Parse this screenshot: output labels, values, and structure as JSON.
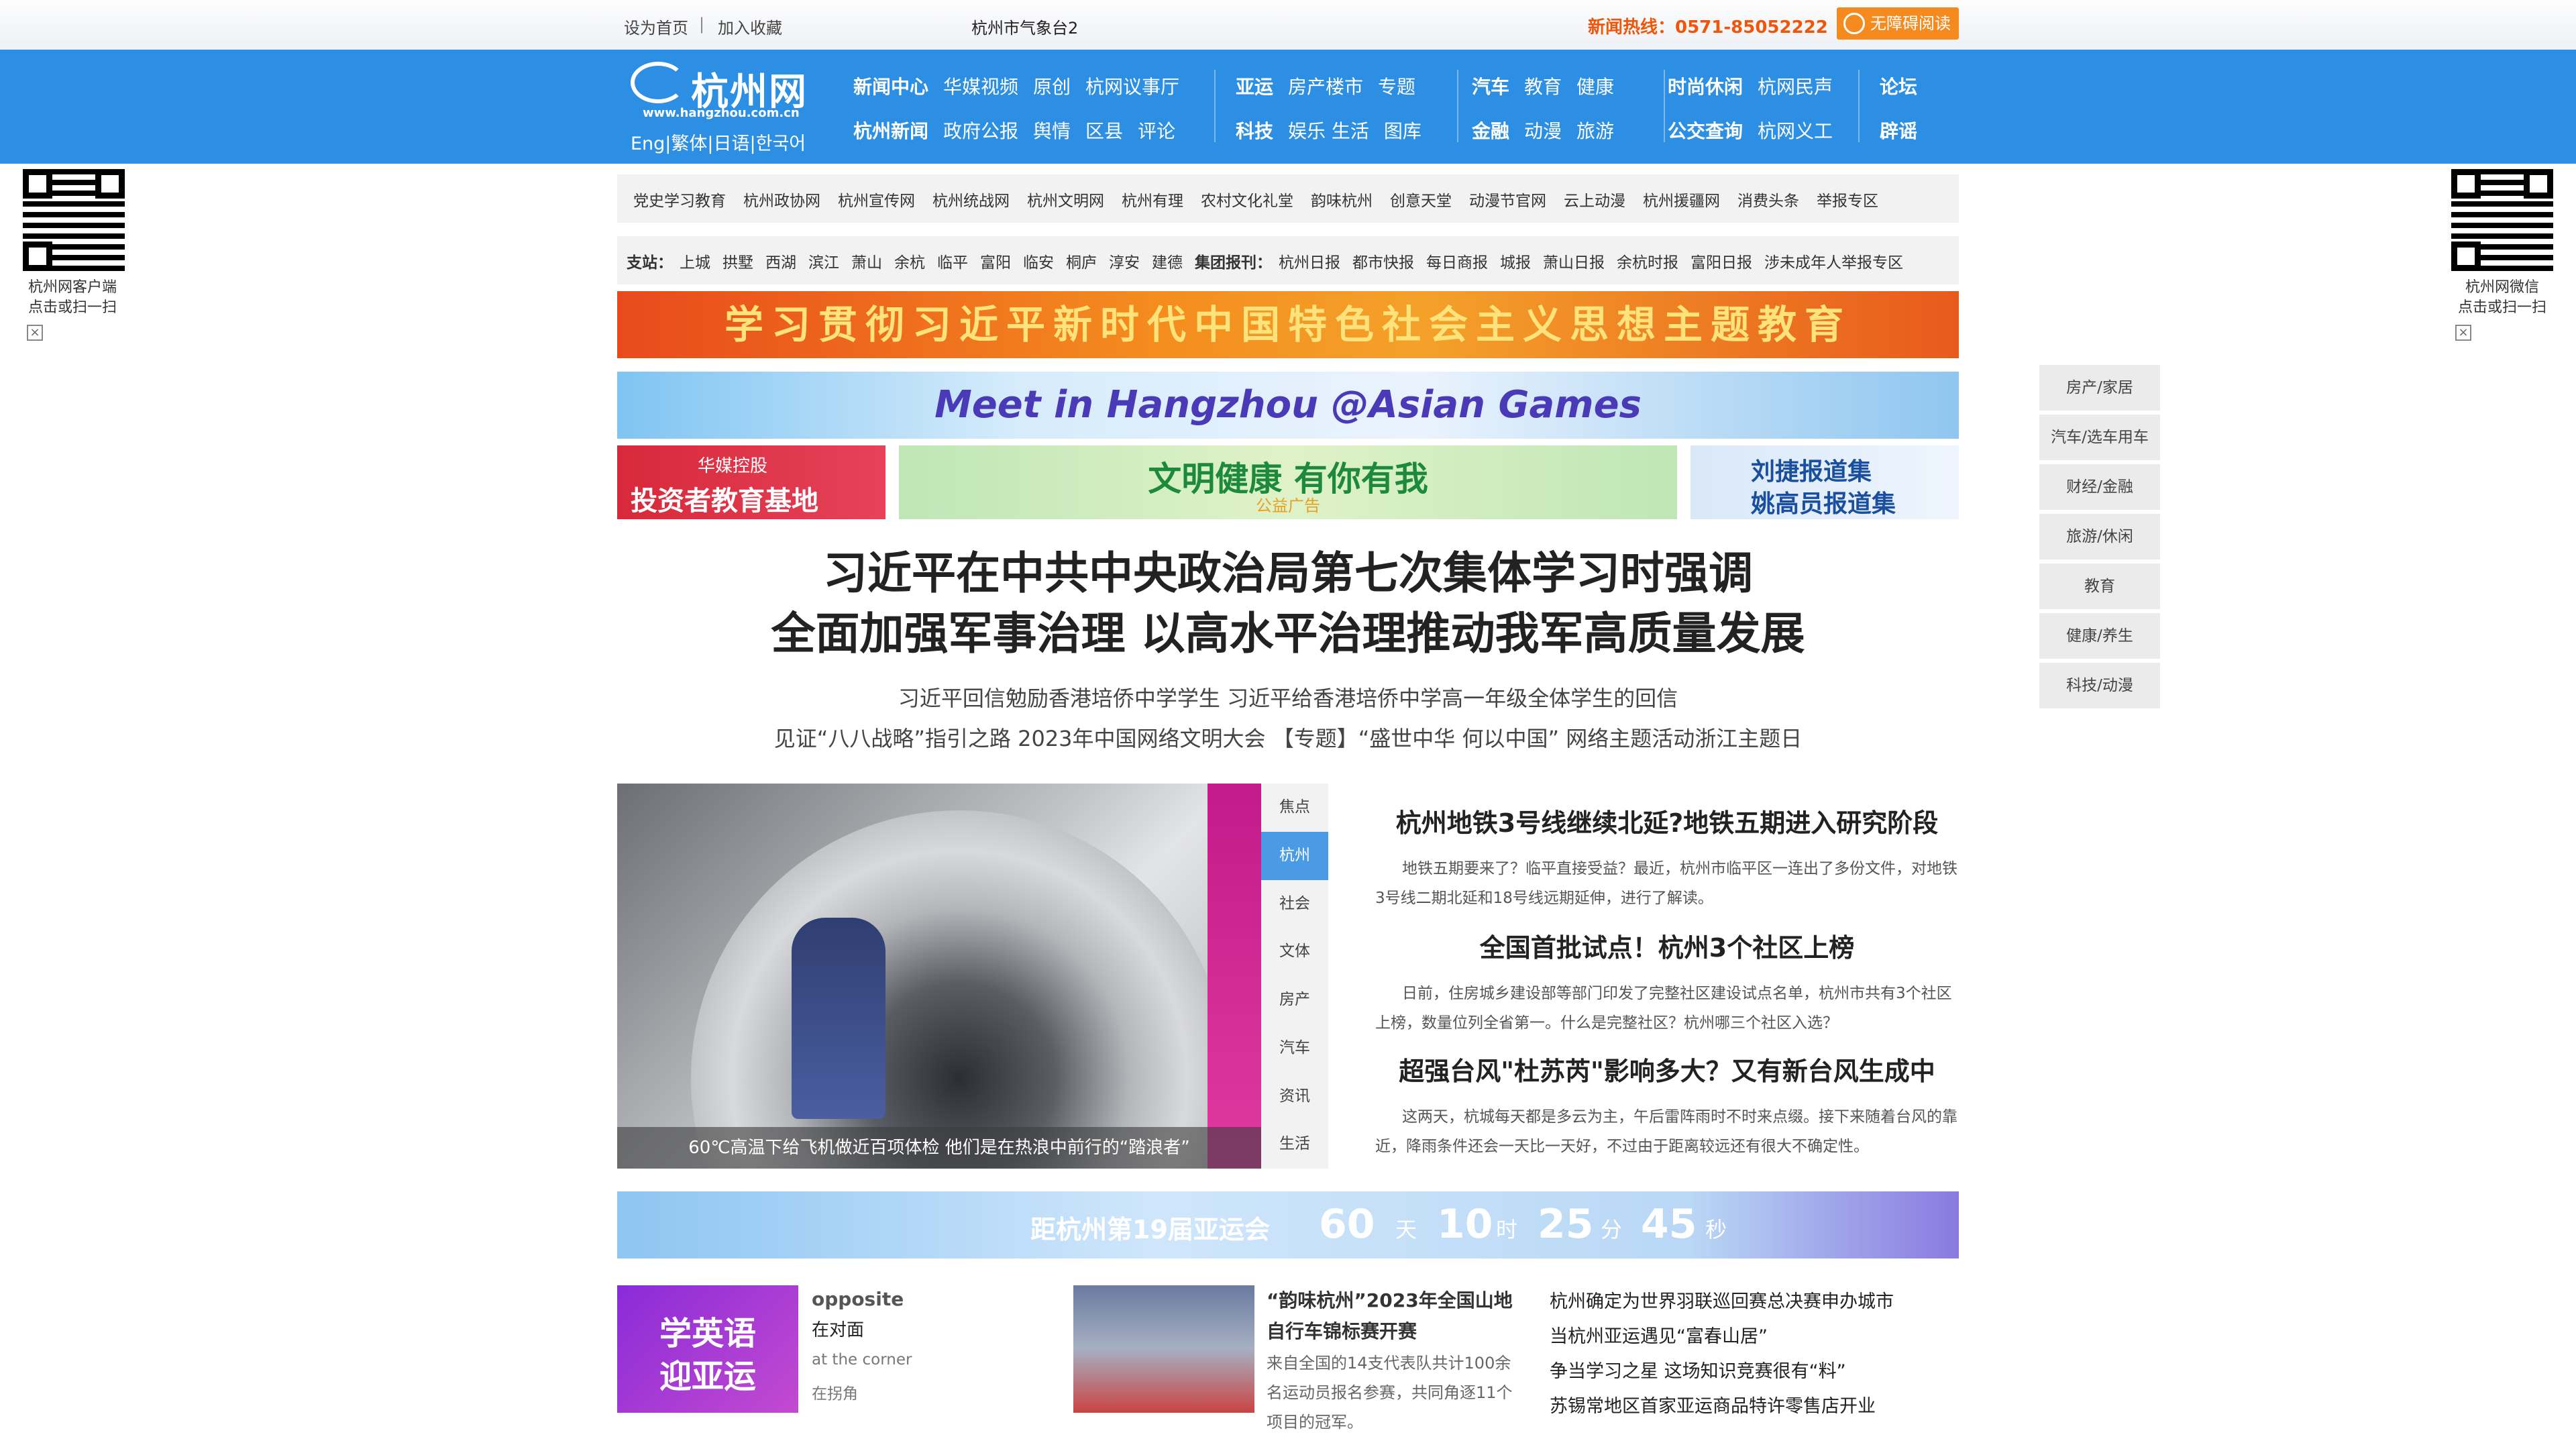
{
  "topbar": {
    "home": "设为首页",
    "sep": "|",
    "fav": "加入收藏",
    "weather": "杭州市气象台2",
    "hotline": "新闻热线：0571-85052222",
    "accessible": "无障碍阅读"
  },
  "logo": {
    "name": "杭州网",
    "url": "www.hangzhou.com.cn"
  },
  "lang": "Eng|繁体|日语|한국어",
  "nav": {
    "g1r1": [
      "新闻中心",
      "华媒视频",
      "原创",
      "杭网议事厅"
    ],
    "g1r2": [
      "杭州新闻",
      "政府公报",
      "舆情",
      "区县",
      "评论"
    ],
    "g2r1": [
      "亚运",
      "房产楼市",
      "专题"
    ],
    "g2r2": [
      "科技",
      "娱乐 生活",
      "图库"
    ],
    "g3r1": [
      "汽车",
      "教育",
      "健康"
    ],
    "g3r2": [
      "金融",
      "动漫",
      "旅游"
    ],
    "g4r1": [
      "时尚休闲",
      "杭网民声"
    ],
    "g4r2": [
      "公交查询",
      "杭网义工"
    ],
    "g5r1": [
      "论坛"
    ],
    "g5r2": [
      "辟谣"
    ]
  },
  "links": [
    "党史学习教育",
    "杭州政协网",
    "杭州宣传网",
    "杭州统战网",
    "杭州文明网",
    "杭州有理",
    "农村文化礼堂",
    "韵味杭州",
    "创意天堂",
    "动漫节官网",
    "云上动漫",
    "杭州援疆网",
    "消费头条",
    "举报专区"
  ],
  "sub": {
    "label": "支站：",
    "stations": [
      "上城",
      "拱墅",
      "西湖",
      "滨江",
      "萧山",
      "余杭",
      "临平",
      "富阳",
      "临安",
      "桐庐",
      "淳安",
      "建德"
    ],
    "group_label": "集团报刊：",
    "papers": [
      "杭州日报",
      "都市快报",
      "每日商报",
      "城报",
      "萧山日报",
      "余杭时报",
      "富阳日报",
      "涉未成年人举报专区"
    ]
  },
  "banners": {
    "b1": "学习贯彻习近平新时代中国特色社会主义思想主题教育",
    "b2": "Meet in Hangzhou @Asian Games",
    "b3a_top": "华媒控股",
    "b3a_main": "投资者教育基地",
    "b3b_main": "文明健康 有你有我",
    "b3b_sub": "公益广告",
    "b3c_1": "刘捷报道集",
    "b3c_2": "姚高员报道集"
  },
  "headline": {
    "l1": "习近平在中共中央政治局第七次集体学习时强调",
    "l2": "全面加强军事治理 以高水平治理推动我军高质量发展",
    "s1": "习近平回信勉励香港培侨中学学生 习近平给香港培侨中学高一年级全体学生的回信",
    "s2": "见证“八八战略”指引之路 2023年中国网络文明大会 【专题】“盛世中华 何以中国” 网络主题活动浙江主题日"
  },
  "photo_caption": "60℃高温下给飞机做近百项体检 他们是在热浪中前行的“踏浪者”",
  "tabs": [
    "焦点",
    "杭州",
    "社会",
    "文体",
    "房产",
    "汽车",
    "资讯",
    "生活"
  ],
  "news": [
    {
      "title": "杭州地铁3号线继续北延?地铁五期进入研究阶段",
      "body": "地铁五期要来了？临平直接受益？最近，杭州市临平区一连出了多份文件，对地铁3号线二期北延和18号线远期延伸，进行了解读。"
    },
    {
      "title": "全国首批试点！杭州3个社区上榜",
      "body": "日前，住房城乡建设部等部门印发了完整社区建设试点名单，杭州市共有3个社区上榜，数量位列全省第一。什么是完整社区？杭州哪三个社区入选？"
    },
    {
      "title": "超强台风\"杜苏芮\"影响多大？又有新台风生成中",
      "body": "这两天，杭城每天都是多云为主，午后雷阵雨时不时来点缀。接下来随着台风的靠近，降雨条件还会一天比一天好，不过由于距离较远还有很大不确定性。"
    }
  ],
  "countdown": {
    "label": "距杭州第19届亚运会",
    "days": "60",
    "d": "天",
    "hours": "10",
    "h": "时",
    "mins": "25",
    "m": "分",
    "secs": "45",
    "s": "秒"
  },
  "english": {
    "badge_l1": "学英语",
    "badge_l2": "迎亚运",
    "w1": "opposite",
    "w1cn": "在对面",
    "w2": "at the corner",
    "w2cn": "在拐角"
  },
  "cycling": {
    "title": "“韵味杭州”2023年全国山地自行车锦标赛开赛",
    "body": "来自全国的14支代表队共计100余名运动员报名参赛，共同角逐11个项目的冠军。"
  },
  "rlist": [
    "杭州确定为世界羽联巡回赛总决赛申办城市",
    "当杭州亚运遇见“富春山居”",
    "争当学习之星 这场知识竞赛很有“料”",
    "苏锡常地区首家亚运商品特许零售店开业"
  ],
  "side": [
    "房产/家居",
    "汽车/选车用车",
    "财经/金融",
    "旅游/休闲",
    "教育",
    "健康/养生",
    "科技/动漫"
  ],
  "qr_left": {
    "l1": "杭州网客户端",
    "l2": "点击或扫一扫"
  },
  "qr_right": {
    "l1": "杭州网微信",
    "l2": "点击或扫一扫"
  },
  "close": "×"
}
